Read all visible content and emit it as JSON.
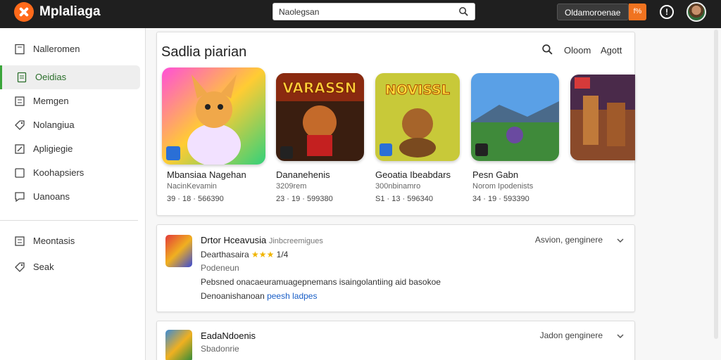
{
  "topbar": {
    "app_title": "Mplaliaga",
    "search_value": "Naolegsan",
    "account_label": "Oldamoroenae",
    "account_badge": "f%",
    "alert_glyph": "!"
  },
  "sidebar": {
    "items": [
      {
        "label": "Nalleromen",
        "icon": "book-icon"
      },
      {
        "label": "Oeidias",
        "icon": "doc-icon",
        "active": true
      },
      {
        "label": "Memgen",
        "icon": "list-icon"
      },
      {
        "label": "Nolangiua",
        "icon": "tag-icon"
      },
      {
        "label": "Apligiegie",
        "icon": "edit-icon"
      },
      {
        "label": "Koohapsiers",
        "icon": "square-icon"
      },
      {
        "label": "Uanoans",
        "icon": "chat-icon"
      }
    ],
    "secondary": [
      {
        "label": "Meontasis",
        "icon": "list-icon"
      },
      {
        "label": "Seak",
        "icon": "tag-icon"
      }
    ]
  },
  "section": {
    "title": "Sadlia piarian",
    "link_a": "Oloom",
    "link_b": "Agott"
  },
  "tiles": [
    {
      "name": "Mbansiaa Nagehan",
      "dev": "NacinKevamin",
      "meta": "39 · 18 · 566390",
      "art_text": ""
    },
    {
      "name": "Dananehenis",
      "dev": "3209rem",
      "meta": "23 · 19 · 599380",
      "art_text": "VARASSN"
    },
    {
      "name": "Geoatia Ibeabdars",
      "dev": "300nbinamro",
      "meta": "S1 · 13 · 596340",
      "art_text": "NOVISSL"
    },
    {
      "name": "Pesn Gabn",
      "dev": "Norom Ipodenists",
      "meta": "34 · 19 · 593390",
      "art_text": ""
    }
  ],
  "reviews": [
    {
      "title": "Drtor Hceavusia",
      "subtitle": "Jinbcreemigues",
      "line1": "Dearthasaira",
      "stars1": "★★★",
      "rating1": "1/4",
      "line2": "Podeneun",
      "body": "Pebsned onacaeuramuagepnemans isaingolantiing aid basokoe",
      "body2_plain": "Denoanishanoan ",
      "body2_link": "peesh ladpes",
      "right": "Asvion, genginere"
    },
    {
      "title": "EadaNdoenis",
      "line1": "Sbadonrie",
      "right": "Jadon genginere"
    }
  ]
}
